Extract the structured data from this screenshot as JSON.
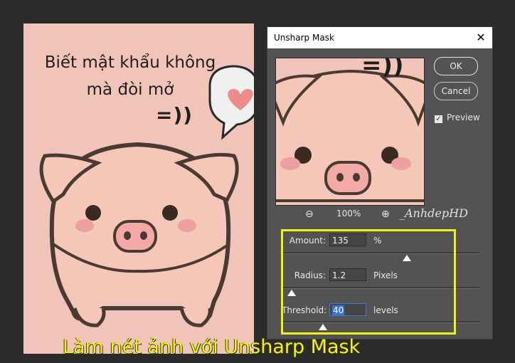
{
  "document": {
    "line1": "Biết mật khẩu không",
    "line2": "mà đòi mở",
    "smile": "=))"
  },
  "dialog": {
    "title": "Unsharp Mask",
    "close_icon": "close-icon",
    "ok_label": "OK",
    "cancel_label": "Cancel",
    "preview_label": "Preview",
    "preview_checked": true,
    "preview_smile": "=))",
    "zoom_level": "100%",
    "watermark": "_AnhdepHD",
    "params": {
      "amount": {
        "label": "Amount:",
        "value": "135",
        "unit": "%"
      },
      "radius": {
        "label": "Radius:",
        "value": "1.2",
        "unit": "Pixels"
      },
      "threshold": {
        "label": "Threshold:",
        "value": "40",
        "unit": "levels"
      }
    }
  },
  "caption": "Làm nét ảnh với Unsharp Mask",
  "colors": {
    "highlight": "#f1f116",
    "caption": "#f2f21e",
    "canvas_bg": "#f0c4b8"
  }
}
